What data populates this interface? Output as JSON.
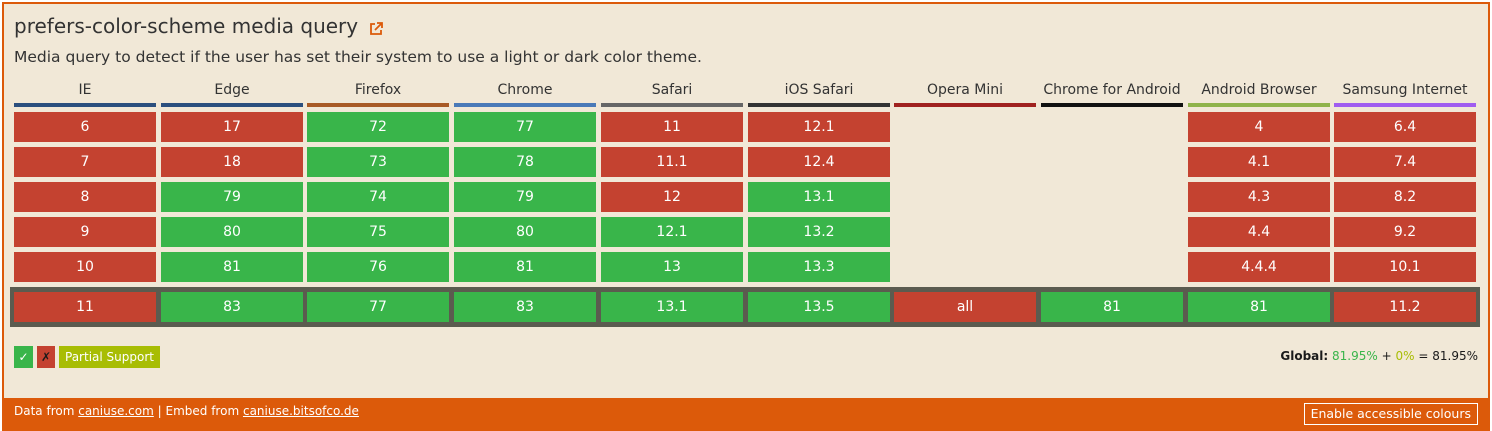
{
  "title": "prefers-color-scheme media query",
  "icons": {
    "external": "external-link-icon"
  },
  "description": "Media query to detect if the user has set their system to use a light or dark color theme.",
  "colors": {
    "brand": "#dc5a0a",
    "supported": "#39b54a",
    "unsupported": "#c44230",
    "partial": "#a8bd04"
  },
  "browsers": [
    {
      "name": "IE",
      "color": "#2b4f7e",
      "versions": [
        {
          "v": "6",
          "s": "n"
        },
        {
          "v": "7",
          "s": "n"
        },
        {
          "v": "8",
          "s": "n"
        },
        {
          "v": "9",
          "s": "n"
        },
        {
          "v": "10",
          "s": "n"
        }
      ],
      "current": {
        "v": "11",
        "s": "n"
      }
    },
    {
      "name": "Edge",
      "color": "#2b4f7e",
      "versions": [
        {
          "v": "17",
          "s": "n"
        },
        {
          "v": "18",
          "s": "n"
        },
        {
          "v": "79",
          "s": "y"
        },
        {
          "v": "80",
          "s": "y"
        },
        {
          "v": "81",
          "s": "y"
        }
      ],
      "current": {
        "v": "83",
        "s": "y"
      }
    },
    {
      "name": "Firefox",
      "color": "#a85a26",
      "versions": [
        {
          "v": "72",
          "s": "y"
        },
        {
          "v": "73",
          "s": "y"
        },
        {
          "v": "74",
          "s": "y"
        },
        {
          "v": "75",
          "s": "y"
        },
        {
          "v": "76",
          "s": "y"
        }
      ],
      "current": {
        "v": "77",
        "s": "y"
      }
    },
    {
      "name": "Chrome",
      "color": "#4a7ab8",
      "versions": [
        {
          "v": "77",
          "s": "y"
        },
        {
          "v": "78",
          "s": "y"
        },
        {
          "v": "79",
          "s": "y"
        },
        {
          "v": "80",
          "s": "y"
        },
        {
          "v": "81",
          "s": "y"
        }
      ],
      "current": {
        "v": "83",
        "s": "y"
      }
    },
    {
      "name": "Safari",
      "color": "#666666",
      "versions": [
        {
          "v": "11",
          "s": "n"
        },
        {
          "v": "11.1",
          "s": "n"
        },
        {
          "v": "12",
          "s": "n"
        },
        {
          "v": "12.1",
          "s": "y"
        },
        {
          "v": "13",
          "s": "y"
        }
      ],
      "current": {
        "v": "13.1",
        "s": "y"
      }
    },
    {
      "name": "iOS Safari",
      "color": "#333333",
      "versions": [
        {
          "v": "12.1",
          "s": "n"
        },
        {
          "v": "12.4",
          "s": "n"
        },
        {
          "v": "13.1",
          "s": "y"
        },
        {
          "v": "13.2",
          "s": "y"
        },
        {
          "v": "13.3",
          "s": "y"
        }
      ],
      "current": {
        "v": "13.5",
        "s": "y"
      }
    },
    {
      "name": "Opera Mini",
      "color": "#a02220",
      "versions": [],
      "current": {
        "v": "all",
        "s": "n"
      }
    },
    {
      "name": "Chrome for Android",
      "color": "#111111",
      "versions": [],
      "current": {
        "v": "81",
        "s": "y"
      }
    },
    {
      "name": "Android Browser",
      "color": "#8fb34a",
      "versions": [
        {
          "v": "4",
          "s": "n"
        },
        {
          "v": "4.1",
          "s": "n"
        },
        {
          "v": "4.3",
          "s": "n"
        },
        {
          "v": "4.4",
          "s": "n"
        },
        {
          "v": "4.4.4",
          "s": "n"
        }
      ],
      "current": {
        "v": "81",
        "s": "y"
      }
    },
    {
      "name": "Samsung Internet",
      "color": "#a05cf0",
      "versions": [
        {
          "v": "6.4",
          "s": "n"
        },
        {
          "v": "7.4",
          "s": "n"
        },
        {
          "v": "8.2",
          "s": "n"
        },
        {
          "v": "9.2",
          "s": "n"
        },
        {
          "v": "10.1",
          "s": "n"
        }
      ],
      "current": {
        "v": "11.2",
        "s": "n"
      }
    }
  ],
  "legend": {
    "supported": "✓",
    "unsupported": "✗",
    "partial": "Partial Support"
  },
  "global": {
    "label": "Global:",
    "supported": "81.95%",
    "plus": "+",
    "partial": "0%",
    "equals": "= 81.95%"
  },
  "footer": {
    "data_from": "Data from",
    "caniuse_link": "caniuse.com",
    "separator": "| Embed from",
    "embed_link": "caniuse.bitsofco.de",
    "accessible_button": "Enable accessible colours"
  }
}
